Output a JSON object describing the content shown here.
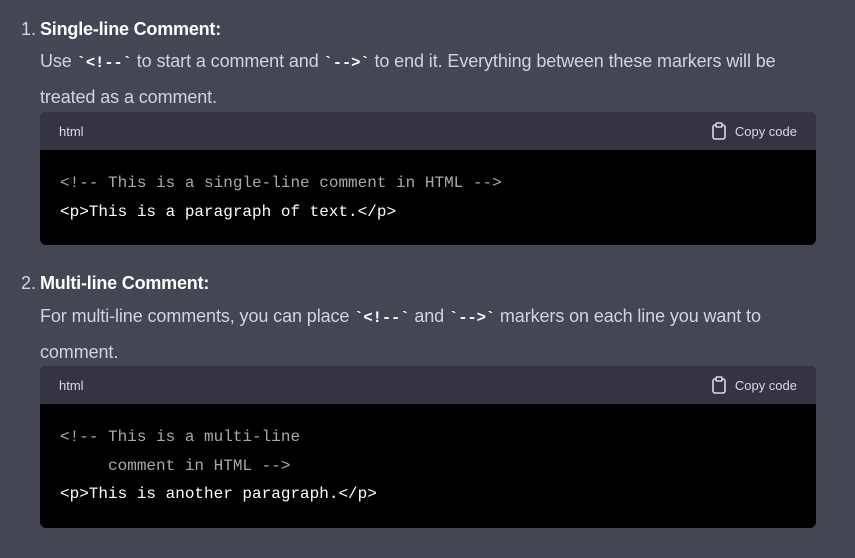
{
  "items": [
    {
      "number": "1.",
      "heading": "Single-line Comment:",
      "text_before": "Use ",
      "code_open": "`<!--`",
      "text_mid": " to start a comment and ",
      "code_close": "`-->`",
      "text_after": " to end it. Everything between these markers will be treated as a comment.",
      "code_block": {
        "language": "html",
        "copy_label": "Copy code",
        "lines": [
          "<!-- This is a single-line comment in HTML -->",
          "<p>This is a paragraph of text.</p>"
        ]
      }
    },
    {
      "number": "2.",
      "heading": "Multi-line Comment:",
      "text_before": "For multi-line comments, you can place ",
      "code_open": "`<!--`",
      "text_mid": " and ",
      "code_close": "`-->`",
      "text_after": " markers on each line you want to comment.",
      "code_block": {
        "language": "html",
        "copy_label": "Copy code",
        "lines": [
          "<!-- This is a multi-line",
          "     comment in HTML -->",
          "<p>This is another paragraph.</p>"
        ]
      }
    }
  ],
  "colors": {
    "background": "#444654",
    "code_header": "#343541",
    "code_body": "#000000",
    "comment_text": "#a9a9a9",
    "code_text": "#ffffff"
  },
  "icons": {
    "copy": "clipboard-icon"
  }
}
